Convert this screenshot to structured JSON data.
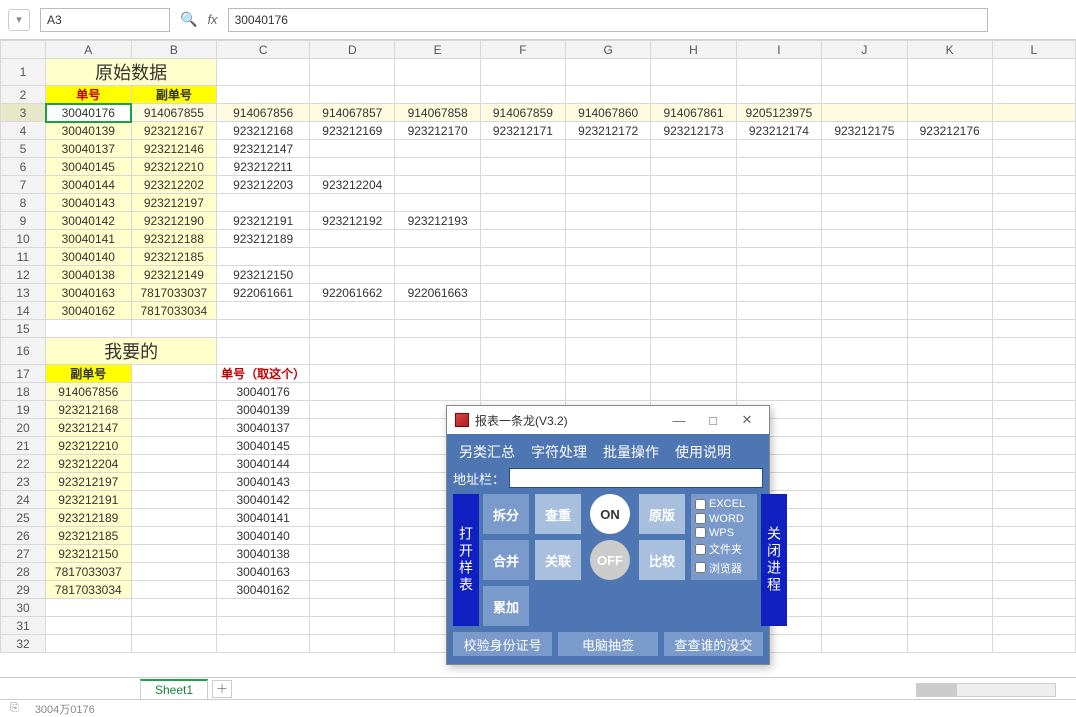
{
  "toolbar": {
    "name_box": "A3",
    "fx": "30040176",
    "fx_label": "fx"
  },
  "columns": [
    "A",
    "B",
    "C",
    "D",
    "E",
    "F",
    "G",
    "H",
    "I",
    "J",
    "K",
    "L"
  ],
  "row_header_count": 32,
  "titles": {
    "raw_data": "原始数据",
    "i_want": "我要的"
  },
  "headers": {
    "danhao": "单号",
    "fudanhao": "副单号",
    "danhao_pick": "单号（取这个）"
  },
  "data_top": [
    [
      "30040176",
      "914067855",
      "914067856",
      "914067857",
      "914067858",
      "914067859",
      "914067860",
      "914067861",
      "9205123975",
      "",
      ""
    ],
    [
      "30040139",
      "923212167",
      "923212168",
      "923212169",
      "923212170",
      "923212171",
      "923212172",
      "923212173",
      "923212174",
      "923212175",
      "923212176"
    ],
    [
      "30040137",
      "923212146",
      "923212147",
      "",
      "",
      "",
      "",
      "",
      "",
      "",
      ""
    ],
    [
      "30040145",
      "923212210",
      "923212211",
      "",
      "",
      "",
      "",
      "",
      "",
      "",
      ""
    ],
    [
      "30040144",
      "923212202",
      "923212203",
      "923212204",
      "",
      "",
      "",
      "",
      "",
      "",
      ""
    ],
    [
      "30040143",
      "923212197",
      "",
      "",
      "",
      "",
      "",
      "",
      "",
      "",
      ""
    ],
    [
      "30040142",
      "923212190",
      "923212191",
      "923212192",
      "923212193",
      "",
      "",
      "",
      "",
      "",
      ""
    ],
    [
      "30040141",
      "923212188",
      "923212189",
      "",
      "",
      "",
      "",
      "",
      "",
      "",
      ""
    ],
    [
      "30040140",
      "923212185",
      "",
      "",
      "",
      "",
      "",
      "",
      "",
      "",
      ""
    ],
    [
      "30040138",
      "923212149",
      "923212150",
      "",
      "",
      "",
      "",
      "",
      "",
      "",
      ""
    ],
    [
      "30040163",
      "7817033037",
      "922061661",
      "922061662",
      "922061663",
      "",
      "",
      "",
      "",
      "",
      ""
    ],
    [
      "30040162",
      "7817033034",
      "",
      "",
      "",
      "",
      "",
      "",
      "",
      "",
      ""
    ]
  ],
  "data_bottom": [
    [
      "914067856",
      "30040176"
    ],
    [
      "923212168",
      "30040139"
    ],
    [
      "923212147",
      "30040137"
    ],
    [
      "923212210",
      "30040145"
    ],
    [
      "923212204",
      "30040144"
    ],
    [
      "923212197",
      "30040143"
    ],
    [
      "923212191",
      "30040142"
    ],
    [
      "923212189",
      "30040141"
    ],
    [
      "923212185",
      "30040140"
    ],
    [
      "923212150",
      "30040138"
    ],
    [
      "7817033037",
      "30040163"
    ],
    [
      "7817033034",
      "30040162"
    ]
  ],
  "sheet_tabs": {
    "active": "Sheet1"
  },
  "status": {
    "left_icon": "⎘",
    "text": "3004万0176"
  },
  "dialog": {
    "title": "报表一条龙(V3.2)",
    "menu": [
      "另类汇总",
      "字符处理",
      "批量操作",
      "使用说明"
    ],
    "addr_label": "地址栏：",
    "side_left": "打开样表",
    "side_right": "关闭进程",
    "buttons": {
      "split": "拆分",
      "merge": "合并",
      "accum": "累加",
      "dedup": "查重",
      "relate": "关联",
      "on": "ON",
      "off": "OFF",
      "orig": "原版",
      "compare": "比较"
    },
    "checks": [
      "EXCEL",
      "WORD",
      "WPS",
      "文件夹",
      "浏览器"
    ],
    "bottom": [
      "校验身份证号",
      "电脑抽签",
      "查查谁的没交"
    ]
  }
}
